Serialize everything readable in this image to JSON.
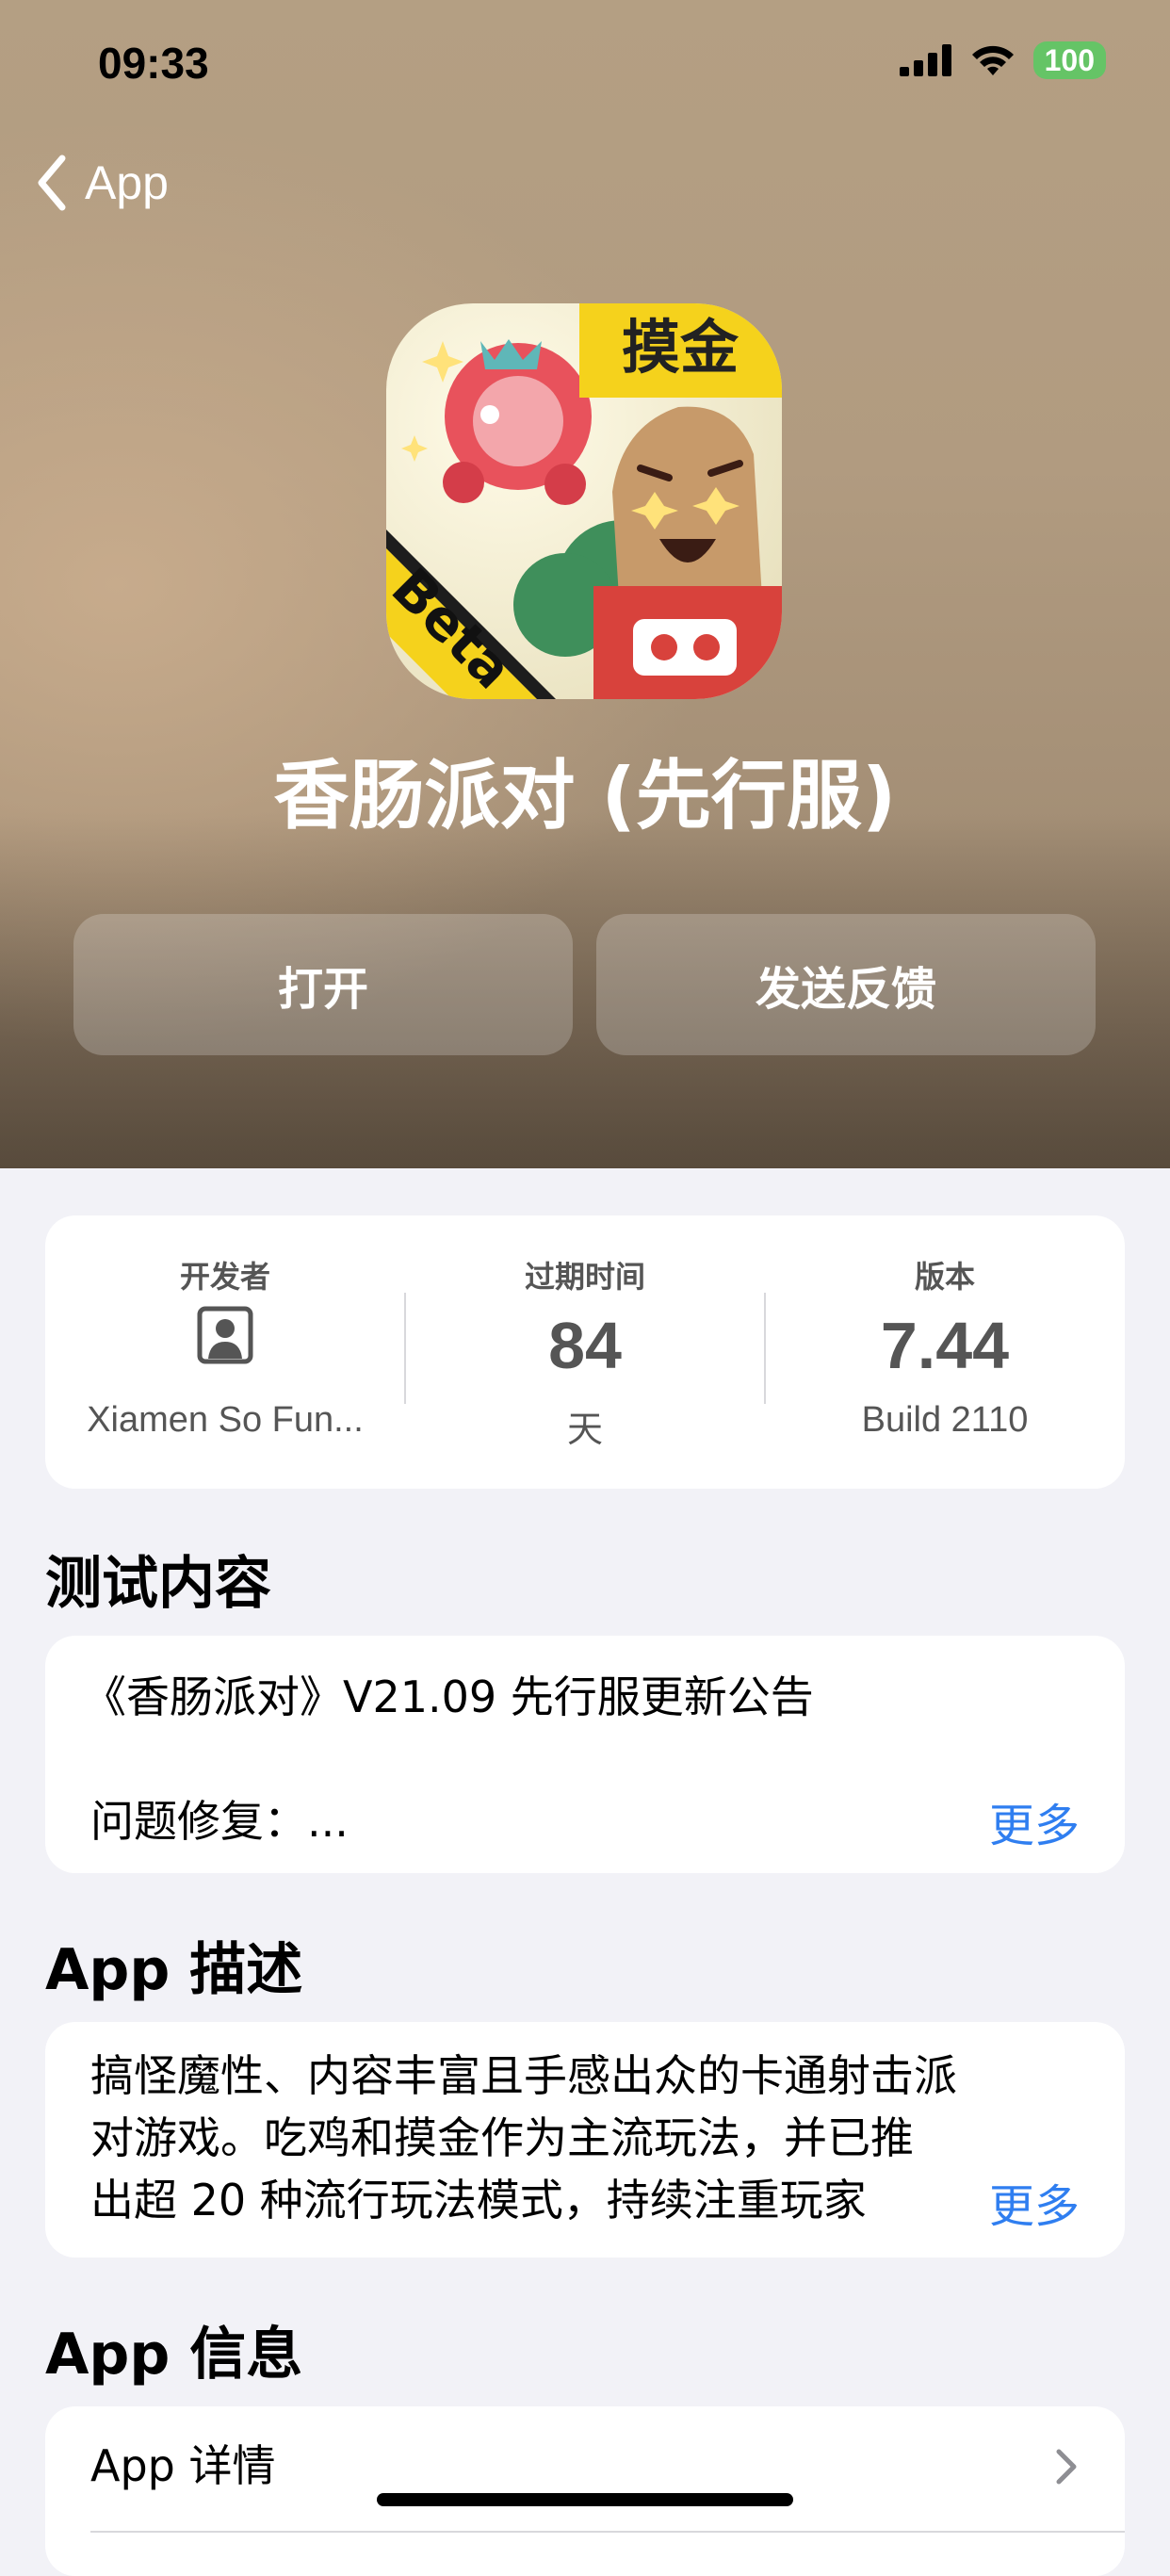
{
  "status_bar": {
    "time": "09:33",
    "battery": "100"
  },
  "nav": {
    "back_label": "App"
  },
  "app": {
    "title": "香肠派对 (先行服)",
    "icon_badge_top": "摸金",
    "icon_badge_corner": "Beta"
  },
  "actions": {
    "open": "打开",
    "feedback": "发送反馈"
  },
  "info": {
    "developer_label": "开发者",
    "developer_value": "Xiamen So Fun...",
    "expiry_label": "过期时间",
    "expiry_value": "84",
    "expiry_unit": "天",
    "version_label": "版本",
    "version_value": "7.44",
    "build": "Build 2110"
  },
  "test_content": {
    "heading": "测试内容",
    "line1": "《香肠派对》V21.09 先行服更新公告",
    "line2": "问题修复：...",
    "more": "更多"
  },
  "description": {
    "heading": "App 描述",
    "line1": "搞怪魔性、内容丰富且手感出众的卡通射击派",
    "line2": "对游戏。吃鸡和摸金作为主流玩法，并已推",
    "line3": "出超 20 种流行玩法模式，持续注重玩家",
    "more": "更多"
  },
  "app_info": {
    "heading": "App 信息",
    "details_label": "App 详情"
  },
  "colors": {
    "accent": "#2f7ef0",
    "battery": "#65c466",
    "background": "#f2f2f7"
  }
}
